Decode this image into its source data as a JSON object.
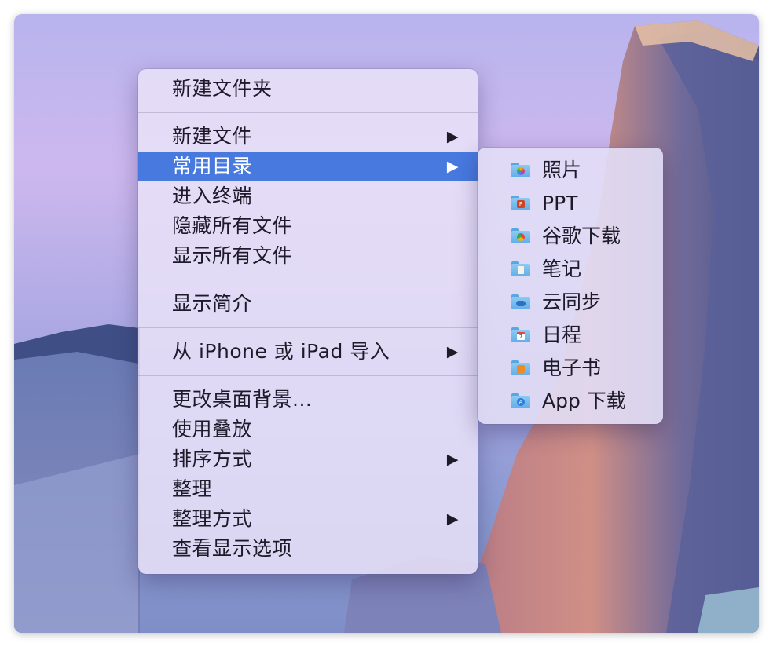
{
  "context_menu": {
    "items": [
      {
        "label": "新建文件夹"
      },
      {
        "label": "新建文件",
        "arrow": "▶"
      },
      {
        "label": "常用目录",
        "arrow": "▶"
      },
      {
        "label": "进入终端"
      },
      {
        "label": "隐藏所有文件"
      },
      {
        "label": "显示所有文件"
      },
      {
        "label": "显示简介"
      },
      {
        "label": "从 iPhone 或 iPad 导入",
        "arrow": "▶"
      },
      {
        "label": "更改桌面背景..."
      },
      {
        "label": "使用叠放"
      },
      {
        "label": "排序方式",
        "arrow": "▶"
      },
      {
        "label": "整理"
      },
      {
        "label": "整理方式",
        "arrow": "▶"
      },
      {
        "label": "查看显示选项"
      }
    ]
  },
  "submenu": {
    "items": [
      {
        "label": "照片",
        "icon": "photos-folder-icon"
      },
      {
        "label": "PPT",
        "icon": "powerpoint-folder-icon"
      },
      {
        "label": "谷歌下载",
        "icon": "chrome-folder-icon"
      },
      {
        "label": "笔记",
        "icon": "notes-folder-icon"
      },
      {
        "label": "云同步",
        "icon": "cloud-folder-icon"
      },
      {
        "label": "日程",
        "icon": "calendar-folder-icon"
      },
      {
        "label": "电子书",
        "icon": "books-folder-icon"
      },
      {
        "label": "App 下载",
        "icon": "appstore-folder-icon"
      }
    ]
  },
  "colors": {
    "highlight": "#4779df",
    "folder": "#62aee6"
  }
}
